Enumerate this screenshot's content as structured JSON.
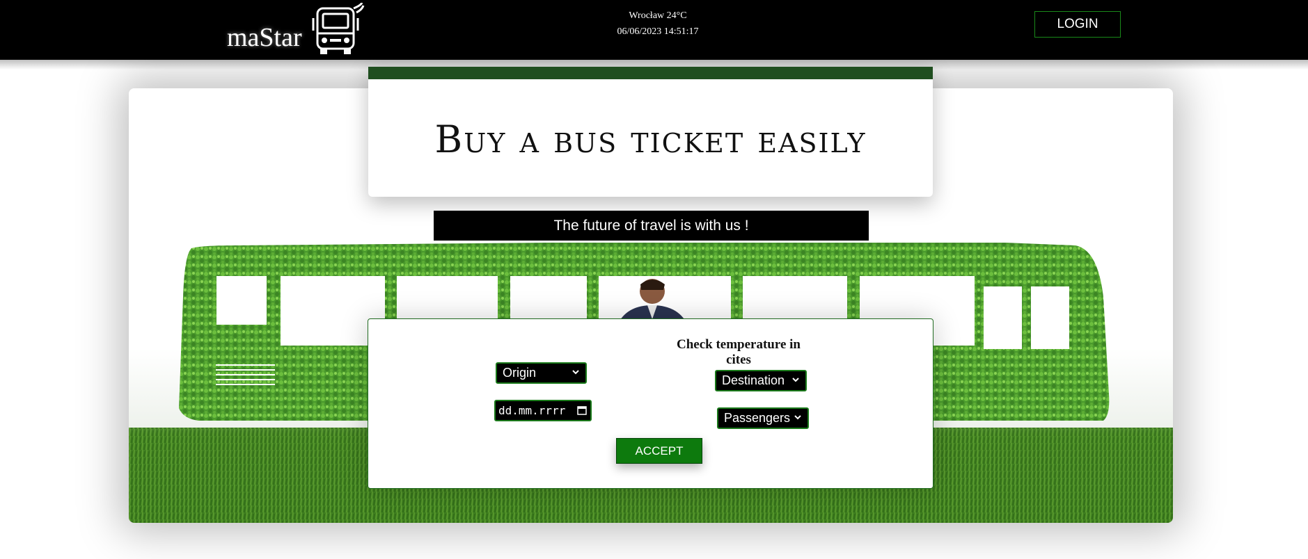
{
  "header": {
    "brand_name": "maStar",
    "weather": "Wrocław 24°C",
    "datetime": "06/06/2023 14:51:17",
    "login_label": "LOGIN"
  },
  "hero": {
    "title": "Buy a bus ticket easily",
    "tagline": "The future of travel is with us !"
  },
  "form": {
    "heading": "Check temperature in cites",
    "origin_value": "Origin",
    "destination_value": "Destination",
    "passengers_value": "Passengers",
    "date_placeholder": "dd.mm.rrrr",
    "accept_label": "ACCEPT"
  },
  "colors": {
    "accent_green": "#0d7a0d",
    "dark_green": "#1f4e1f",
    "header_bg": "#000000"
  },
  "icons": [
    "bus-logo-icon",
    "chevron-down-icon",
    "calendar-icon"
  ]
}
